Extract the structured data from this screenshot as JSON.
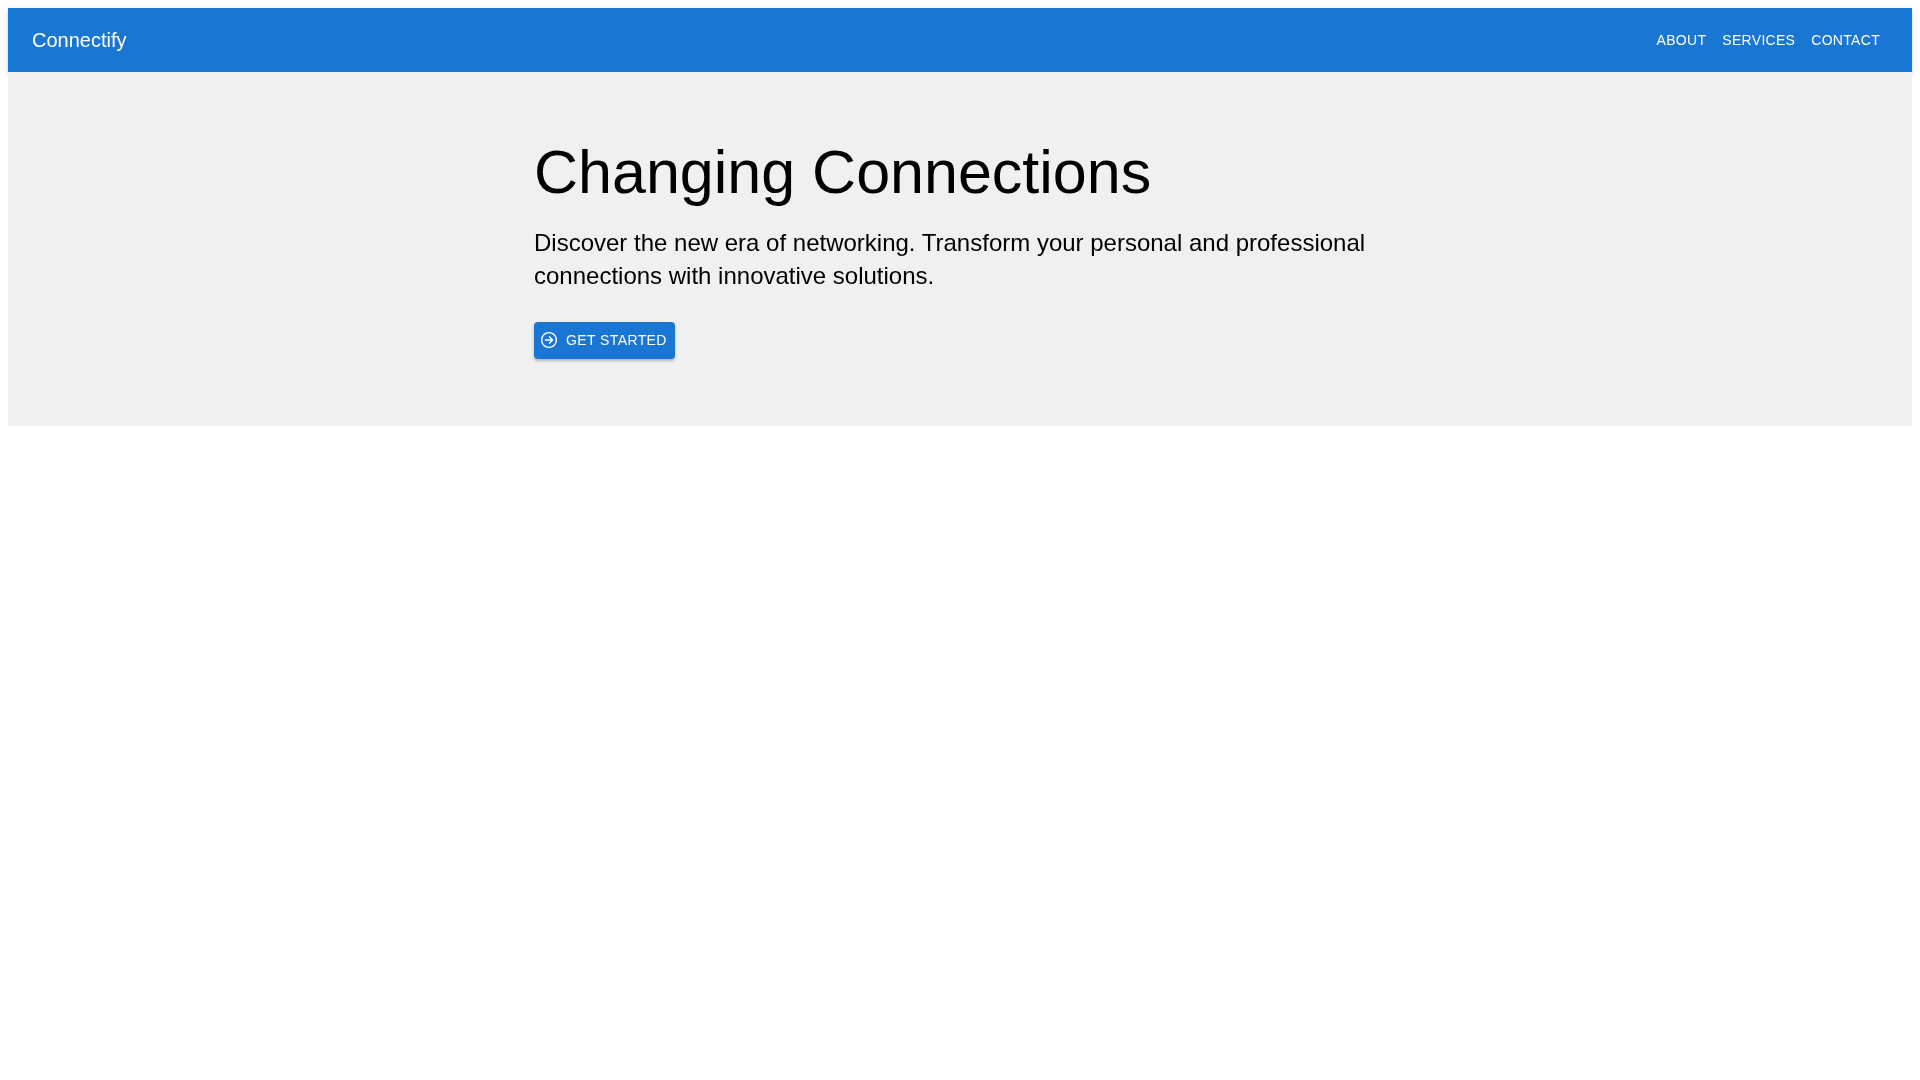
{
  "header": {
    "brand": "Connectify",
    "nav": [
      {
        "label": "ABOUT"
      },
      {
        "label": "SERVICES"
      },
      {
        "label": "CONTACT"
      }
    ]
  },
  "hero": {
    "title": "Changing Connections",
    "subtitle": "Discover the new era of networking. Transform your personal and professional connections with innovative solutions.",
    "button": "GET STARTED"
  }
}
